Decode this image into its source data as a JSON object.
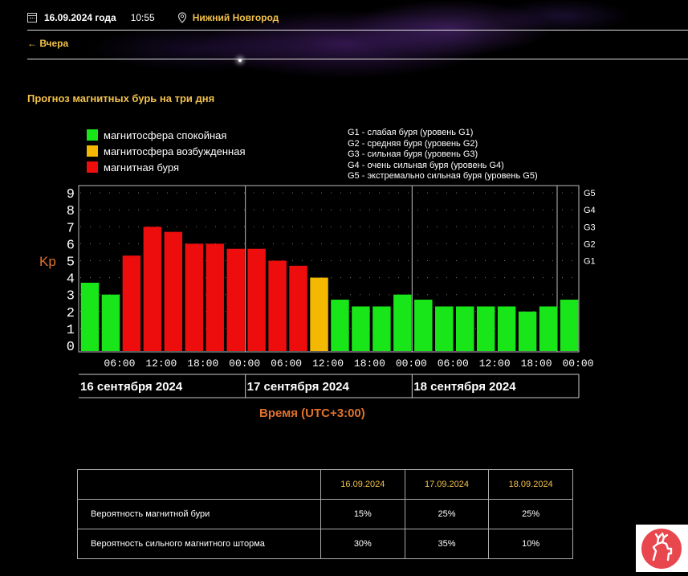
{
  "header": {
    "date": "16.09.2024 года",
    "time": "10:55",
    "city": "Нижний Новгород",
    "back_link": "← Вчера"
  },
  "section_title": "Прогноз магнитных бурь на три дня",
  "legend": [
    {
      "label": "магнитосфера спокойная",
      "color": "#19e619"
    },
    {
      "label": "магнитосфера возбужденная",
      "color": "#f5b800"
    },
    {
      "label": "магнитная буря",
      "color": "#ee0d0d"
    }
  ],
  "g_legend": [
    "G1 - слабая буря (уровень G1)",
    "G2 - средняя буря (уровень G2)",
    "G3 - сильная буря (уровень G3)",
    "G4 - очень сильная буря (уровень G4)",
    "G5 - экстремально сильная буря (уровень G5)"
  ],
  "chart_data": {
    "type": "bar",
    "ylabel": "Kp",
    "xlabel": "Время (UTC+3:00)",
    "ylim": [
      0,
      9
    ],
    "y_ticks": [
      "0",
      "1",
      "2",
      "3",
      "4",
      "5",
      "6",
      "7",
      "8",
      "9"
    ],
    "g_ticks": [
      {
        "label": "G1",
        "value": 5
      },
      {
        "label": "G2",
        "value": 6
      },
      {
        "label": "G3",
        "value": 7
      },
      {
        "label": "G4",
        "value": 8
      },
      {
        "label": "G5",
        "value": 9
      }
    ],
    "x_tick_labels": [
      "06:00",
      "12:00",
      "18:00",
      "00:00",
      "06:00",
      "12:00",
      "18:00",
      "00:00",
      "06:00",
      "12:00",
      "18:00",
      "00:00"
    ],
    "days": [
      "16 сентября 2024",
      "17 сентября 2024",
      "18 сентября 2024"
    ],
    "values": [
      3.7,
      3.0,
      5.3,
      7.0,
      6.7,
      6.0,
      6.0,
      5.7,
      5.7,
      5.0,
      4.7,
      4.0,
      2.7,
      2.3,
      2.3,
      3.0,
      2.7,
      2.3,
      2.3,
      2.3,
      2.3,
      2.0,
      2.3,
      2.7
    ],
    "levels": [
      "calm",
      "calm",
      "storm",
      "storm",
      "storm",
      "storm",
      "storm",
      "storm",
      "storm",
      "storm",
      "storm",
      "excited",
      "calm",
      "calm",
      "calm",
      "calm",
      "calm",
      "calm",
      "calm",
      "calm",
      "calm",
      "calm",
      "calm",
      "calm"
    ],
    "colors": {
      "calm": "#19e619",
      "excited": "#f5b800",
      "storm": "#ee0d0d"
    },
    "grid": true
  },
  "table": {
    "columns": [
      "",
      "16.09.2024",
      "17.09.2024",
      "18.09.2024"
    ],
    "rows": [
      [
        "Вероятность магнитной бури",
        "15%",
        "25%",
        "25%"
      ],
      [
        "Вероятность сильного магнитного шторма",
        "30%",
        "35%",
        "10%"
      ]
    ]
  },
  "colors": {
    "accent": "#f2c14b",
    "axis_title": "#e0712c"
  },
  "logo": {
    "icon": "deer-icon",
    "bg": "#e8474e"
  }
}
